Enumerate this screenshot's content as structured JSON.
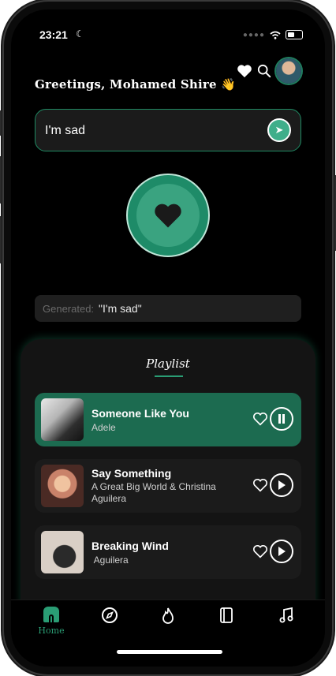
{
  "status_bar": {
    "time": "23:21"
  },
  "header": {
    "greeting": "Greetings,  Mohamed Shire 👋"
  },
  "mood_input": {
    "value": "I'm sad"
  },
  "generated": {
    "label": "Generated:",
    "value": "\"I'm sad\""
  },
  "playlist": {
    "title": "Playlist",
    "songs": [
      {
        "title": "Someone Like You",
        "artist": "Adele",
        "playing": true
      },
      {
        "title": "Say Something",
        "artist": "A Great Big World & Christina Aguilera",
        "playing": false
      },
      {
        "title": "Breaking Wind",
        "artist": " Aguilera",
        "playing": false
      }
    ]
  },
  "nav": {
    "items": [
      {
        "label": "Home",
        "icon": "home-icon"
      },
      {
        "label": "",
        "icon": "compass-icon"
      },
      {
        "label": "",
        "icon": "flame-icon"
      },
      {
        "label": "",
        "icon": "book-icon"
      },
      {
        "label": "",
        "icon": "music-note-icon"
      }
    ]
  },
  "colors": {
    "accent": "#2a9d74",
    "active_row": "#1c6b50",
    "background": "#000000"
  }
}
